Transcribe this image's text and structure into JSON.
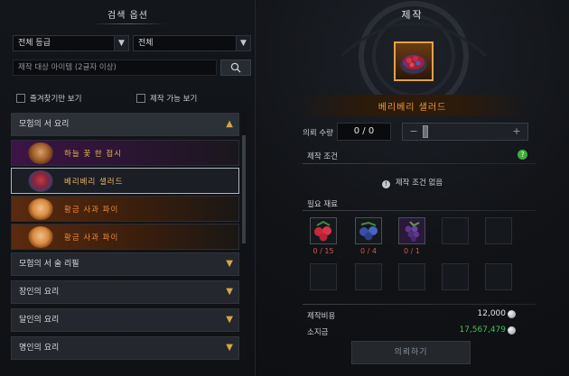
{
  "search": {
    "title": "검색 옵션",
    "grade_select": "전체 등급",
    "type_select": "전체",
    "input_placeholder": "제작 대상 아이템 (2글자 이상)",
    "favorites_only_label": "즐겨찾기만 보기",
    "craftable_only_label": "제작 가능 보기"
  },
  "categories": [
    {
      "label": "모험의 서 요리",
      "expanded": true,
      "recipes": [
        {
          "name": "하늘 꽃 한 접시",
          "rarity": "purple"
        },
        {
          "name": "베리베리 샐러드",
          "rarity": "selected"
        },
        {
          "name": "황금 사과 파이",
          "rarity": "orange"
        },
        {
          "name": "황금 사과 파이",
          "rarity": "orange"
        }
      ]
    },
    {
      "label": "모험의 서 술 리필",
      "expanded": false
    },
    {
      "label": "장인의 요리",
      "expanded": false
    },
    {
      "label": "달인의 요리",
      "expanded": false
    },
    {
      "label": "명인의 요리",
      "expanded": false
    }
  ],
  "craft": {
    "title": "제작",
    "item_name": "베리베리 샐러드",
    "quantity_label": "의뢰 수량",
    "quantity_value": "0 / 0",
    "conditions_label": "제작 조건",
    "no_conditions_text": "제작 조건 없음",
    "materials_label": "필요 재료",
    "materials": [
      {
        "icon": "red-berries-icon",
        "count": "0 / 15"
      },
      {
        "icon": "blue-berries-icon",
        "count": "0 / 4"
      },
      {
        "icon": "purple-grapes-icon",
        "count": "0 / 1"
      }
    ],
    "cost_label": "제작비용",
    "cost_value": "12,000",
    "owned_label": "소지금",
    "owned_value": "17,567,479",
    "request_button": "의뢰하기"
  },
  "colors": {
    "accent_gold": "#e2a24a",
    "item_orange": "#f09a3a",
    "owned_green": "#47c05a",
    "count_red": "#d05a4e"
  }
}
